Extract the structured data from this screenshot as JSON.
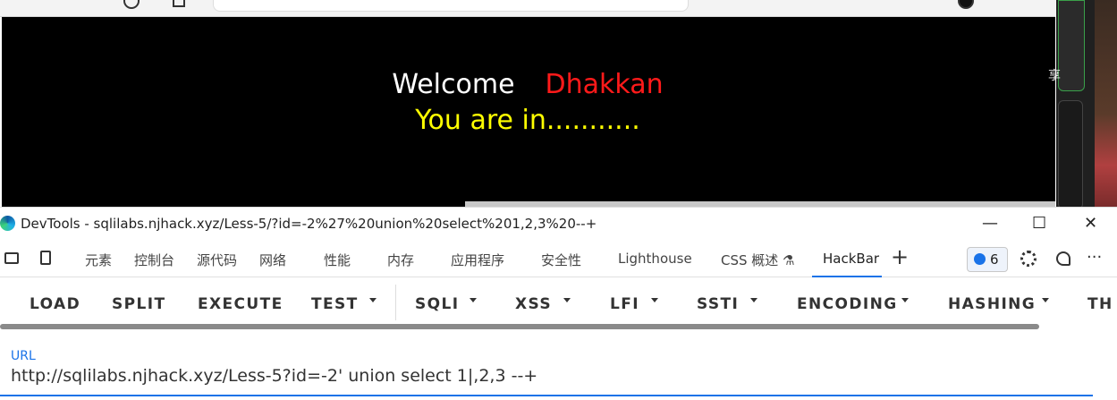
{
  "page": {
    "welcome_label": "Welcome",
    "user_name": "Dhakkan",
    "status_text": "You are in..........."
  },
  "side_panel": {
    "text": "享"
  },
  "devtools": {
    "title": "DevTools - sqlilabs.njhack.xyz/Less-5/?id=-2%27%20union%20select%201,2,3%20--+",
    "window_buttons": {
      "minimize": "—",
      "maximize": "☐",
      "close": "✕"
    },
    "tabs": [
      "元素",
      "控制台",
      "源代码",
      "网络",
      "性能",
      "内存",
      "应用程序",
      "安全性",
      "Lighthouse",
      "CSS 概述 ⚗"
    ],
    "active_tab": "HackBar",
    "add_tab": "+",
    "issues_count": "6",
    "more": "···"
  },
  "hackbar": {
    "buttons": [
      "LOAD",
      "SPLIT",
      "EXECUTE",
      "TEST",
      "SQLI",
      "XSS",
      "LFI",
      "SSTI",
      "ENCODING",
      "HASHING",
      "TH"
    ],
    "url_label": "URL",
    "url_value": "http://sqlilabs.njhack.xyz/Less-5?id=-2' union select 1|,2,3 --+"
  },
  "colors": {
    "accent": "#1a73e8",
    "welcome": "#ffffff",
    "user_name": "#ff1a1a",
    "status": "#ffff00",
    "page_bg": "#000000"
  }
}
